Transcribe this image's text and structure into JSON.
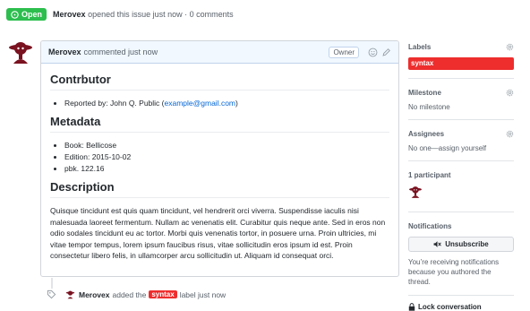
{
  "issue": {
    "status": "Open",
    "author": "Merovex",
    "opened_text": "opened this issue just now · 0 comments"
  },
  "comment": {
    "author": "Merovex",
    "meta": "commented just now",
    "role_badge": "Owner",
    "sections": {
      "contributor": {
        "heading": "Contrbutor",
        "reporter_prefix": "Reported by: John Q. Public (",
        "email": "example@gmail.com",
        "reporter_suffix": ")"
      },
      "metadata": {
        "heading": "Metadata",
        "items": [
          "Book: Bellicose",
          "Edition: 2015-10-02",
          "pbk. 122.16"
        ]
      },
      "description": {
        "heading": "Description",
        "text": "Quisque tincidunt est quis quam tincidunt, vel hendrerit orci viverra. Suspendisse iaculis nisi malesuada laoreet fermentum. Nullam ac venenatis elit. Curabitur quis neque ante. Sed in eros non odio sodales tincidunt eu ac tortor. Morbi quis venenatis tortor, in posuere urna. Proin ultricies, mi vitae tempor tempus, lorem ipsum faucibus risus, vitae sollicitudin eros ipsum id est. Proin consectetur libero felis, in ullamcorper arcu sollicitudin ut. Aliquam id consequat orci."
      }
    }
  },
  "sidebar": {
    "labels": {
      "title": "Labels",
      "items": [
        "syntax"
      ]
    },
    "milestone": {
      "title": "Milestone",
      "value": "No milestone"
    },
    "assignees": {
      "title": "Assignees",
      "value": "No one—assign yourself"
    },
    "participants": {
      "title": "1 participant"
    },
    "notifications": {
      "title": "Notifications",
      "button_label": "Unsubscribe",
      "text": "You’re receiving notifications because you authored the thread."
    },
    "lock": {
      "label": "Lock conversation"
    }
  },
  "event": {
    "actor": "Merovex",
    "before": "added the",
    "label": "syntax",
    "after": "label just now"
  },
  "colors": {
    "open_green": "#2cbe4e",
    "label_red": "#ee2d2d",
    "link_blue": "#0366d6",
    "avatar_maroon": "#7a1220"
  },
  "icons": [
    "issue-opened-icon",
    "emoji-icon",
    "pencil-icon",
    "gear-icon",
    "mute-icon",
    "lock-icon",
    "tag-icon"
  ]
}
